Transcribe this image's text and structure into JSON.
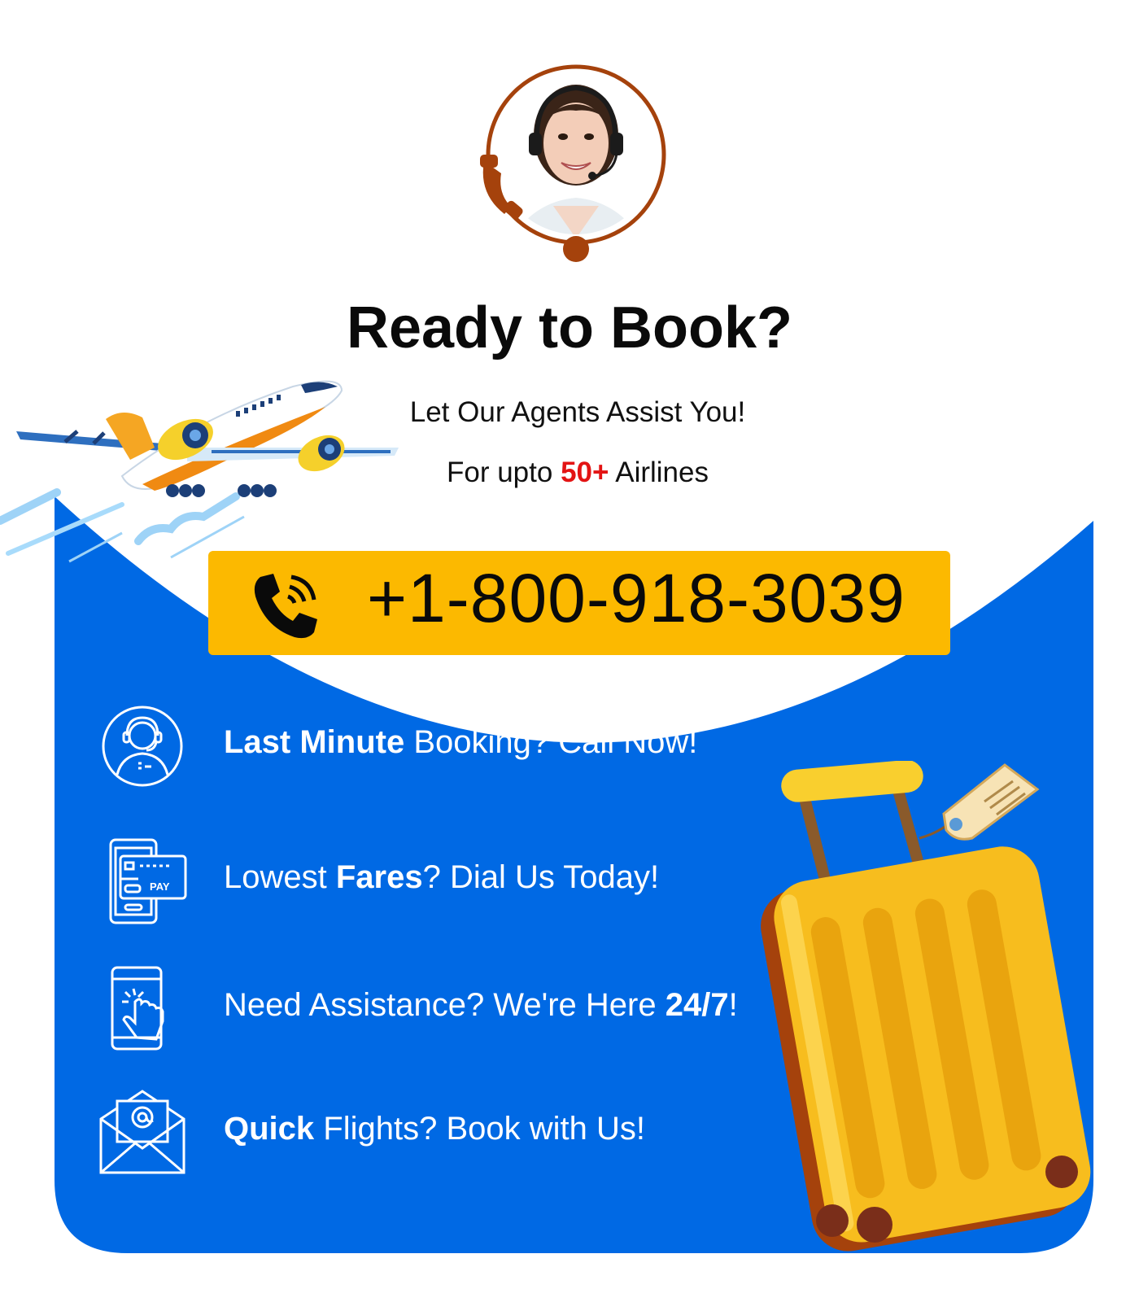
{
  "header": {
    "title": "Ready to Book?",
    "subtitle": "Let Our Agents Assist You!",
    "airlines_prefix": "For upto ",
    "airlines_count": "50+",
    "airlines_suffix": " Airlines"
  },
  "call": {
    "phone": "+1-800-918-3039"
  },
  "features": [
    {
      "bold": "Last Minute",
      "rest": " Booking? Call Now!",
      "icon": "agent-headset-icon"
    },
    {
      "pre": "Lowest ",
      "bold": "Fares",
      "rest": "? Dial Us Today!",
      "icon": "mobile-pay-icon"
    },
    {
      "pre": "Need Assistance? We're Here ",
      "bold": "24/7",
      "rest": "!",
      "icon": "touch-phone-icon"
    },
    {
      "bold": "Quick",
      "rest": " Flights? Book with Us!",
      "icon": "email-icon"
    }
  ],
  "icon_labels": {
    "pay": "PAY"
  },
  "colors": {
    "panel_blue": "#0069e4",
    "call_yellow": "#fcb900",
    "accent_red": "#e31414",
    "agent_ring": "#a5420c"
  }
}
